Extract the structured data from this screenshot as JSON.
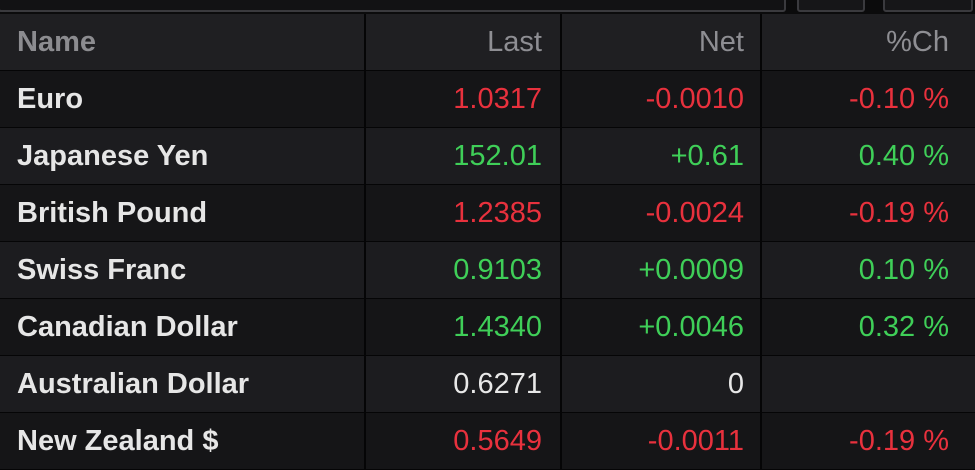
{
  "columns": {
    "name": "Name",
    "last": "Last",
    "net": "Net",
    "pct": "%Ch"
  },
  "colors": {
    "up": "#3fcf58",
    "down": "#e8313d",
    "flat": "#e8e8e8"
  },
  "rows": [
    {
      "name": "Euro",
      "last": "1.0317",
      "net": "-0.0010",
      "pct": "-0.10 %",
      "dir": "down"
    },
    {
      "name": "Japanese Yen",
      "last": "152.01",
      "net": "+0.61",
      "pct": "0.40 %",
      "dir": "up"
    },
    {
      "name": "British Pound",
      "last": "1.2385",
      "net": "-0.0024",
      "pct": "-0.19 %",
      "dir": "down"
    },
    {
      "name": "Swiss Franc",
      "last": "0.9103",
      "net": "+0.0009",
      "pct": "0.10 %",
      "dir": "up"
    },
    {
      "name": "Canadian Dollar",
      "last": "1.4340",
      "net": "+0.0046",
      "pct": "0.32 %",
      "dir": "up"
    },
    {
      "name": "Australian Dollar",
      "last": "0.6271",
      "net": "0",
      "pct": "",
      "dir": "flat"
    },
    {
      "name": "New Zealand $",
      "last": "0.5649",
      "net": "-0.0011",
      "pct": "-0.19 %",
      "dir": "down"
    }
  ]
}
